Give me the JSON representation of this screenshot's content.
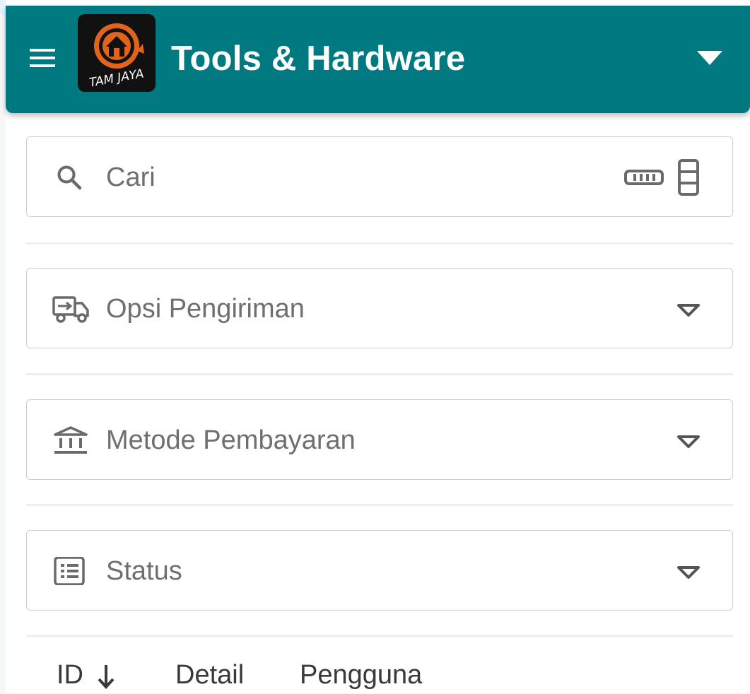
{
  "header": {
    "menu_icon": "hamburger-menu-icon",
    "logo_text": "TAM JAYA",
    "title": "Tools & Hardware",
    "dropdown_icon": "triangle-down-icon",
    "bar_color": "#007a80"
  },
  "search": {
    "placeholder": "Cari",
    "value": "",
    "icon": "search-icon",
    "scan_icons": [
      "barcode-icon",
      "qr-scan-icon"
    ]
  },
  "filters": [
    {
      "label": "Opsi Pengiriman",
      "icon": "shipping-truck-icon"
    },
    {
      "label": "Metode Pembayaran",
      "icon": "bank-icon"
    },
    {
      "label": "Status",
      "icon": "list-icon"
    }
  ],
  "table": {
    "columns": [
      {
        "label": "ID",
        "sort": "descending",
        "sort_icon": "arrow-down-icon"
      },
      {
        "label": "Detail"
      },
      {
        "label": "Pengguna"
      }
    ]
  }
}
